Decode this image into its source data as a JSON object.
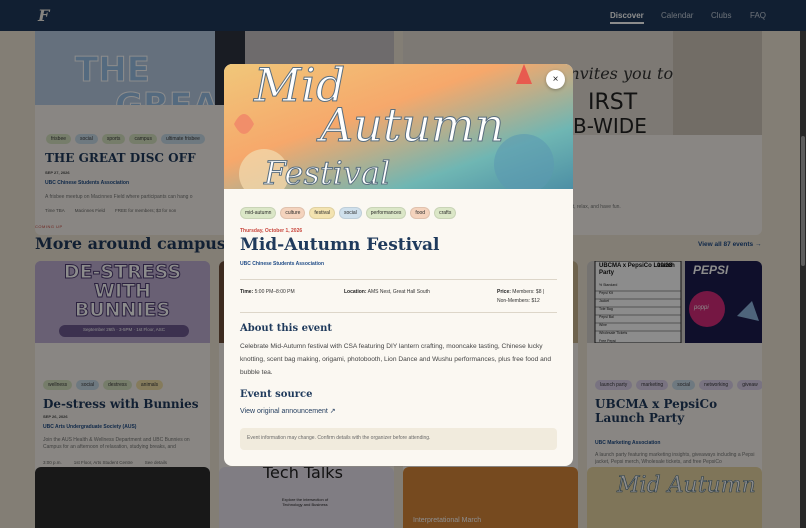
{
  "nav": {
    "logo": "F",
    "items": [
      {
        "label": "Discover",
        "active": true
      },
      {
        "label": "Calendar",
        "active": false
      },
      {
        "label": "Clubs",
        "active": false
      },
      {
        "label": "FAQ",
        "active": false
      }
    ]
  },
  "featured_card": {
    "tags": [
      "frisbee",
      "social",
      "sports",
      "campus",
      "ultimate frisbee"
    ],
    "title": "THE GREAT DISC OFF",
    "date": "SEP 27, 2026",
    "org": "UBC Chinese Students Association",
    "desc": "A frisbee meetup on Macinnes Field where participants can hang o",
    "meta": [
      "Time TBA",
      "Macinnes Field",
      "FREE for members; $3 for non"
    ]
  },
  "featured_card_right": {
    "desc": "ncert, relax, and have fun."
  },
  "section": {
    "kicker": "COMING UP",
    "title": "More around campus",
    "view_all": "View all 87 events →"
  },
  "cards": [
    {
      "banner": [
        "DE-STRESS",
        "WITH",
        "BUNNIES"
      ],
      "banner_sub": "September 26th · 3-5PM · 1st Floor, ASC",
      "tags": [
        "wellness",
        "social",
        "destress",
        "animals"
      ],
      "title": "De-stress with Bunnies",
      "date": "SEP 26, 2026",
      "org": "UBC Arts Undergraduate Society (AUS)",
      "desc": "Join the AUS Health & Wellness Department and UBC Bunnies on Campus for an afternoon of relaxation, studying breaks, and",
      "meta": [
        "3:00 p.m.",
        "1st Floor, Arts Student Centre",
        "See details"
      ]
    },
    {
      "tags": [
        "launch party",
        "marketing",
        "social",
        "networking",
        "giveaw"
      ],
      "title": "UBCMA x PepsiCo Launch Party",
      "date": "SEP 29, 2026",
      "org": "UBC Marketing Association",
      "desc": "A launch party featuring marketing insights, giveaways including a Pepsi jacket, Pepsi merch, Wholesale tickets, and free PepsiCo",
      "meta": [
        "6:00 p.m.",
        "UBC Sauder Ray A Conference Rooms",
        "$5"
      ],
      "panel": {
        "date": "09/28",
        "heading": "UBCMA x PepsiCo Launch Party",
        "brand": "PEPSI",
        "facts_rows": [
          "% Standard",
          "Pepsi Kit",
          "Jacket",
          "Tote Bag",
          "Pepsi Bal",
          "Wine",
          "Wholesale Tickets",
          "Free Pepsi"
        ],
        "soda": "poppi"
      }
    }
  ],
  "bottom_cards": [
    {
      "title": "Tech Talks",
      "sub": "Explore the intersection of Technology and Business"
    },
    {
      "title": "Interpretational March"
    },
    {
      "title": "Mid Autumn"
    }
  ],
  "modal": {
    "hero_text": [
      "Mid",
      "Autumn",
      "Festival"
    ],
    "close": "×",
    "tags": [
      {
        "label": "mid-autumn",
        "color": "#dbe7c7"
      },
      {
        "label": "culture",
        "color": "#f4d3bd"
      },
      {
        "label": "festival",
        "color": "#f3e3b0"
      },
      {
        "label": "social",
        "color": "#cfe0ec"
      },
      {
        "label": "performances",
        "color": "#dbe7c7"
      },
      {
        "label": "food",
        "color": "#f4d3bd"
      },
      {
        "label": "crafts",
        "color": "#dbe7c7"
      }
    ],
    "date": "Thursday, October 1, 2026",
    "title": "Mid-Autumn Festival",
    "org": "UBC Chinese Students Association",
    "time_label": "Time:",
    "time": "5:00 PM–8:00 PM",
    "location_label": "Location:",
    "location": "AMS Nest, Great Hall South",
    "price_label": "Price:",
    "price_line1": "Members: $8 |",
    "price_line2": "Non-Members: $12",
    "about_heading": "About this event",
    "about": "Celebrate Mid-Autumn festival with CSA featuring DIY lantern crafting, mooncake tasting, Chinese lucky knotting, scent bag making, origami, photobooth, Lion Dance and Wushu performances, plus free food and bubble tea.",
    "source_heading": "Event source",
    "source_link": "View original announcement ↗",
    "note": "Event information may change. Confirm details with the organizer before attending."
  },
  "colors": {
    "navy": "#1f3a5c",
    "cream": "#efe6d6",
    "accent_red": "#c9463d",
    "link_blue": "#1f4b86"
  }
}
